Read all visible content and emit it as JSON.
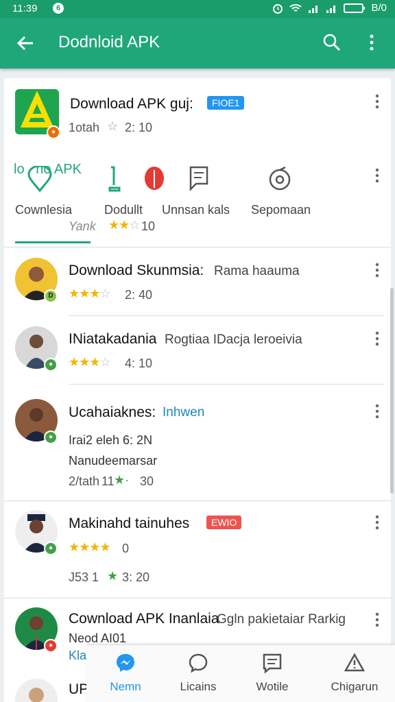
{
  "status": {
    "time": "11:39",
    "notification": "6",
    "battery": "B/0"
  },
  "appbar": {
    "title": "Dodnloid APK"
  },
  "top_app": {
    "name": "Download APK guj:",
    "tag": "FIOE1",
    "rating_text": "1otah",
    "score": "2: 10",
    "colors": {
      "tag": "#2196f3"
    }
  },
  "tabs": [
    {
      "label": "Cownlesia",
      "title_overlay": "lo   no APK"
    },
    {
      "label": "Dodullt"
    },
    {
      "label": "Unnsan kals"
    },
    {
      "label": "Sepomaan"
    }
  ],
  "tab_row_sub": {
    "text": "Yank",
    "score": "10"
  },
  "items": [
    {
      "title": "Download Skunmsia:",
      "subtitle": "Rama haauma",
      "score": "2: 40",
      "badge": "D"
    },
    {
      "title": "INiatakadania",
      "subtitle": "Rogtiaa IDacja leroeivia",
      "score": "4: 10",
      "badge": ""
    },
    {
      "title": "Ucahaiaknes:",
      "subtitle": "Inhwen",
      "line2": "Irai2 eleh 6: 2N",
      "line3": "Nanudeemarsar",
      "line4": "2/tath",
      "line4_mid": "11",
      "score": "30",
      "badge": ""
    },
    {
      "title": "Makinahd tainuhes",
      "tag": "EWIO",
      "score": "0",
      "line2": "J53 1",
      "line2_score": "3: 20",
      "badge": ""
    },
    {
      "title": "Cownload APK Inanlaia",
      "subtitle": "Ggln pakietaiar Rarkig",
      "line2": "Neod AI01",
      "line3": "Kla",
      "badge": ""
    },
    {
      "title": "UPU",
      "badge": ""
    }
  ],
  "bottom_nav": [
    {
      "label": "Nemn",
      "icon": "messenger-icon",
      "active": true
    },
    {
      "label": "Licains",
      "icon": "chat-bubble-icon",
      "active": false
    },
    {
      "label": "Wotile",
      "icon": "message-list-icon",
      "active": false
    },
    {
      "label": "Chigarun",
      "icon": "warning-icon",
      "active": false
    }
  ]
}
